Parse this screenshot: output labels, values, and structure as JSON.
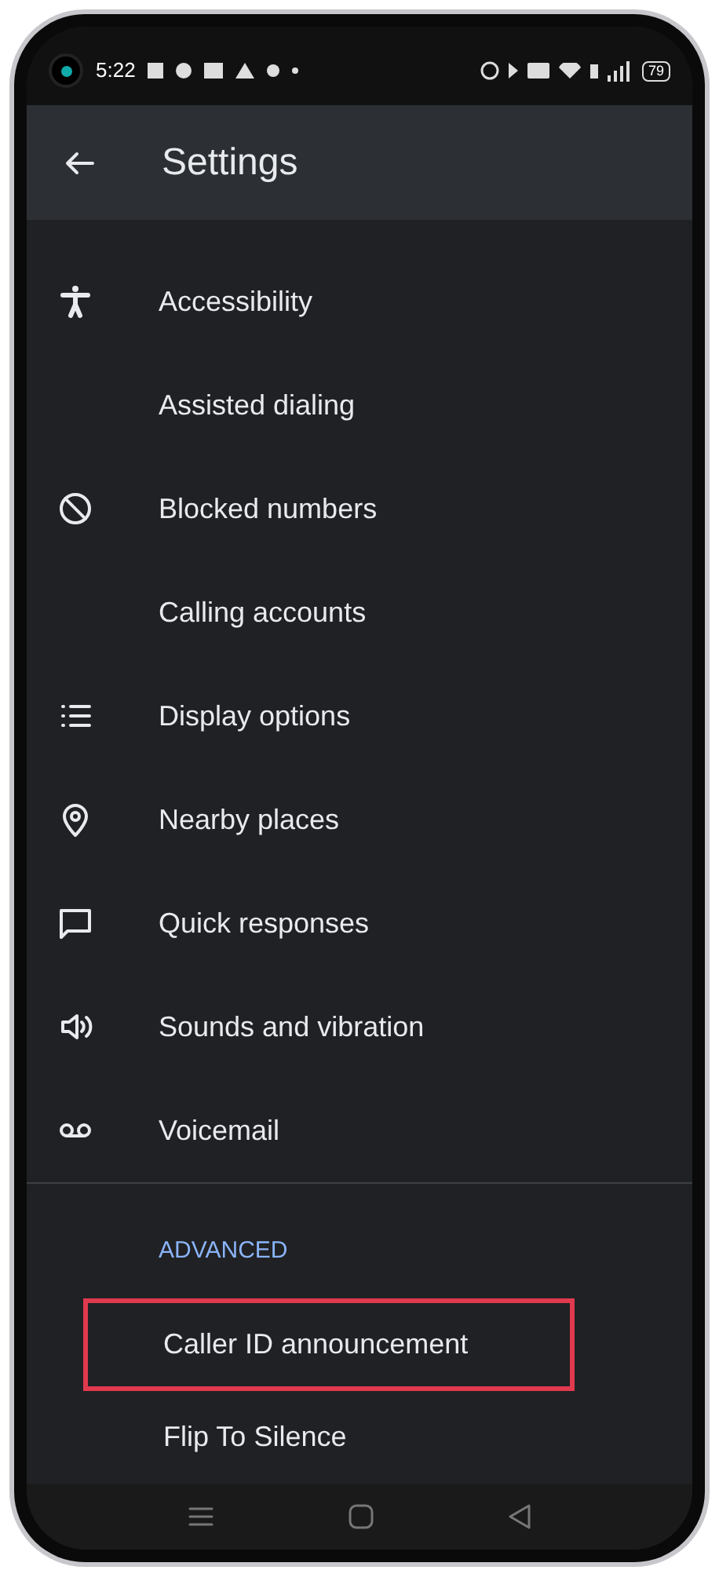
{
  "status_bar": {
    "time": "5:22",
    "battery": "79"
  },
  "header": {
    "title": "Settings"
  },
  "items": [
    {
      "label": "Accessibility",
      "icon": true
    },
    {
      "label": "Assisted dialing",
      "icon": false
    },
    {
      "label": "Blocked numbers",
      "icon": true
    },
    {
      "label": "Calling accounts",
      "icon": false
    },
    {
      "label": "Display options",
      "icon": true
    },
    {
      "label": "Nearby places",
      "icon": true
    },
    {
      "label": "Quick responses",
      "icon": true
    },
    {
      "label": "Sounds and vibration",
      "icon": true
    },
    {
      "label": "Voicemail",
      "icon": true
    }
  ],
  "advanced": {
    "heading": "ADVANCED",
    "items": [
      {
        "label": "Caller ID announcement",
        "highlighted": true
      },
      {
        "label": "Flip To Silence",
        "highlighted": false
      }
    ]
  }
}
